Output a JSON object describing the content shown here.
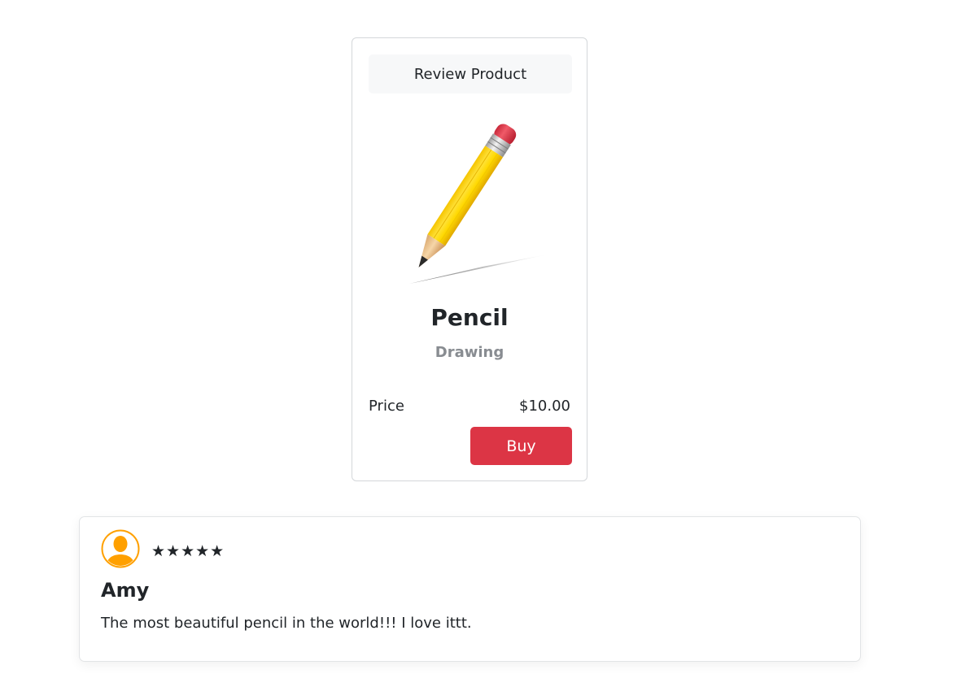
{
  "product": {
    "review_button_label": "Review Product",
    "image_icon": "pencil-icon",
    "name": "Pencil",
    "category": "Drawing",
    "price_label": "Price",
    "price_value": "$10.00",
    "buy_button_label": "Buy",
    "accent_color": "#dc3545"
  },
  "review": {
    "avatar_icon": "user-avatar-icon",
    "avatar_color": "#ffa000",
    "rating": 5,
    "stars": "★★★★★",
    "reviewer": "Amy",
    "text": "The most beautiful pencil in the world!!! I love ittt."
  }
}
